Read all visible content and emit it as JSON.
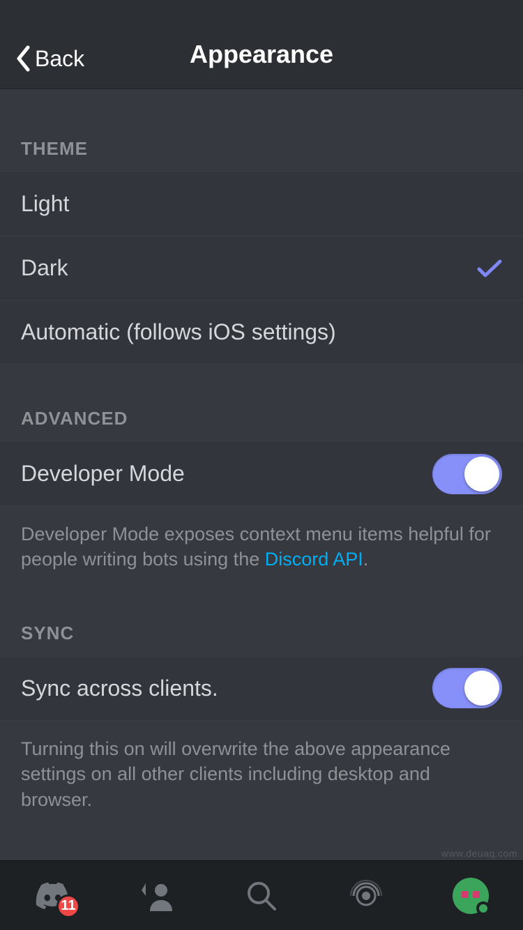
{
  "header": {
    "back_label": "Back",
    "title": "Appearance"
  },
  "sections": {
    "theme": {
      "header": "THEME",
      "options": [
        {
          "label": "Light",
          "selected": false
        },
        {
          "label": "Dark",
          "selected": true
        },
        {
          "label": "Automatic (follows iOS settings)",
          "selected": false
        }
      ]
    },
    "advanced": {
      "header": "ADVANCED",
      "developer_mode": {
        "label": "Developer Mode",
        "enabled": true
      },
      "description_pre": "Developer Mode exposes context menu items helpful for people writing bots using the ",
      "description_link": "Discord API",
      "description_post": "."
    },
    "sync": {
      "header": "SYNC",
      "sync_clients": {
        "label": "Sync across clients.",
        "enabled": true
      },
      "description": "Turning this on will overwrite the above appearance settings on all other clients including desktop and browser."
    }
  },
  "tabbar": {
    "badge_count": "11"
  },
  "colors": {
    "accent": "#8690f8",
    "link": "#00aff4",
    "bg_header": "#2c2f33",
    "bg_body": "#36393f",
    "bg_row": "#32353b",
    "bg_tabbar": "#1e2124"
  },
  "watermark": "www.deuaq.com"
}
